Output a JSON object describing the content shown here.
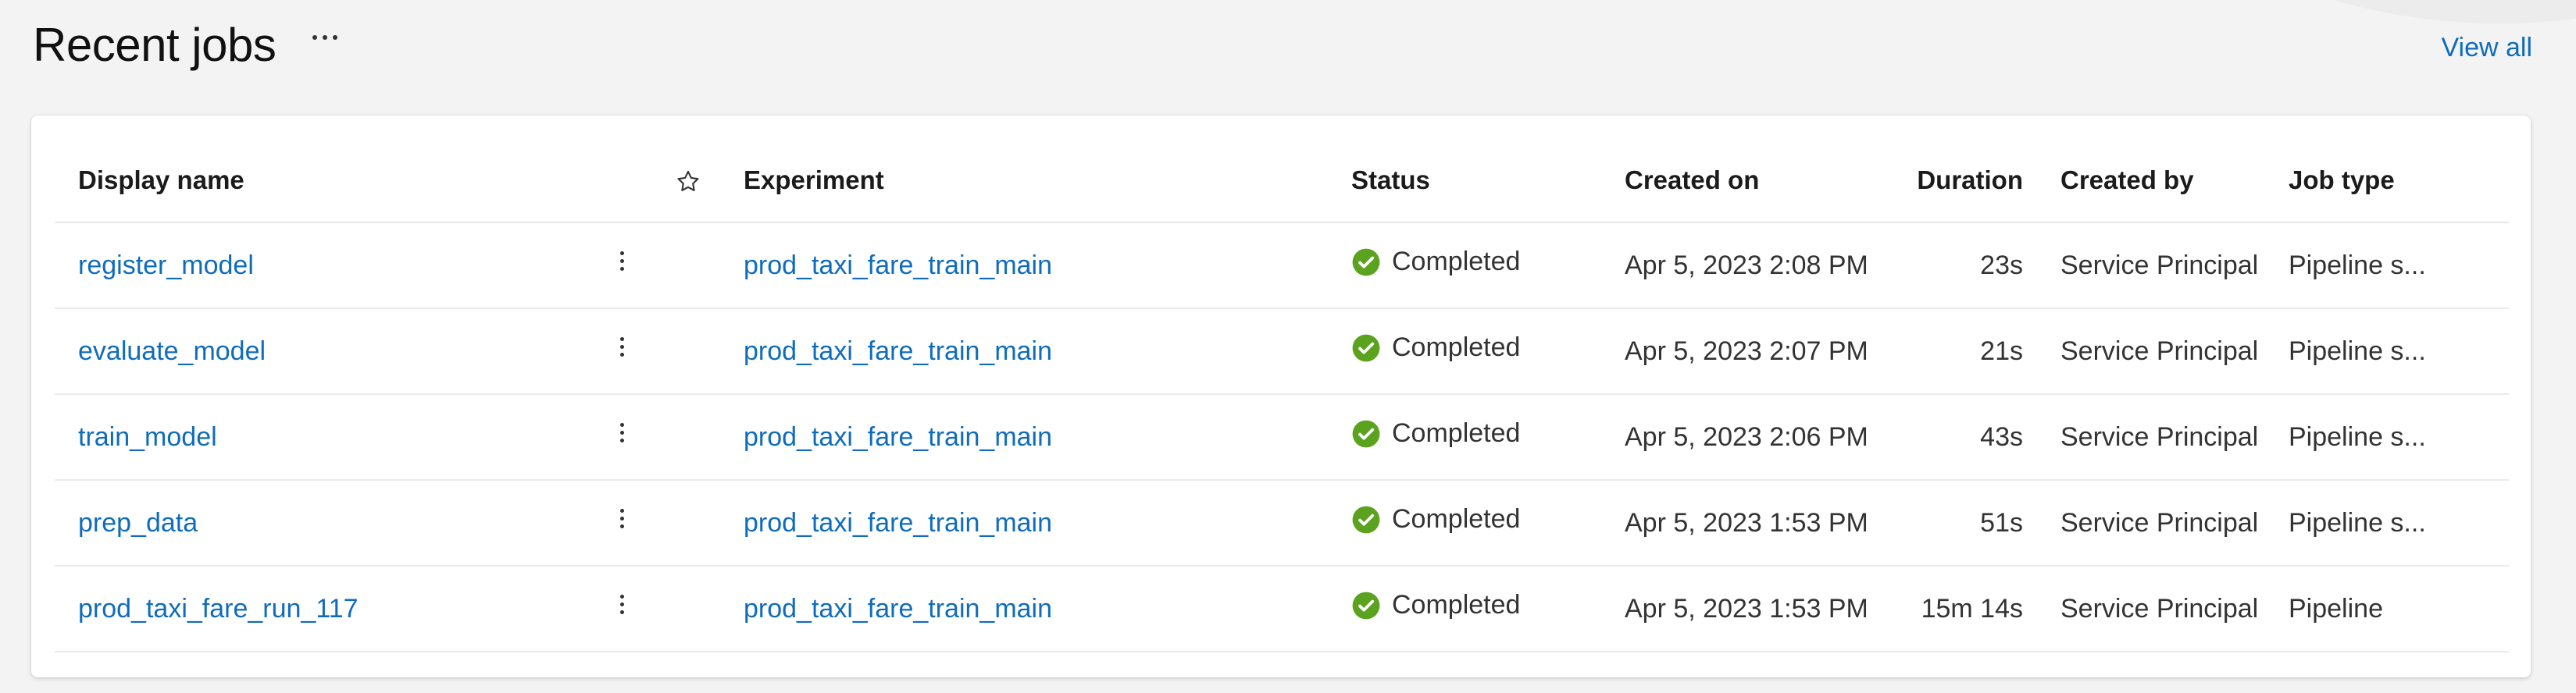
{
  "header": {
    "title": "Recent jobs",
    "more_icon": "more-horizontal-icon",
    "view_all_label": "View all"
  },
  "table": {
    "columns": {
      "display_name": "Display name",
      "favorite_icon": "star-icon",
      "experiment": "Experiment",
      "status": "Status",
      "created_on": "Created on",
      "duration": "Duration",
      "created_by": "Created by",
      "job_type": "Job type"
    },
    "rows": [
      {
        "display_name": "register_model",
        "experiment": "prod_taxi_fare_train_main",
        "status": "Completed",
        "created_on": "Apr 5, 2023 2:08 PM",
        "duration": "23s",
        "created_by": "Service Principal",
        "job_type": "Pipeline s..."
      },
      {
        "display_name": "evaluate_model",
        "experiment": "prod_taxi_fare_train_main",
        "status": "Completed",
        "created_on": "Apr 5, 2023 2:07 PM",
        "duration": "21s",
        "created_by": "Service Principal",
        "job_type": "Pipeline s..."
      },
      {
        "display_name": "train_model",
        "experiment": "prod_taxi_fare_train_main",
        "status": "Completed",
        "created_on": "Apr 5, 2023 2:06 PM",
        "duration": "43s",
        "created_by": "Service Principal",
        "job_type": "Pipeline s..."
      },
      {
        "display_name": "prep_data",
        "experiment": "prod_taxi_fare_train_main",
        "status": "Completed",
        "created_on": "Apr 5, 2023 1:53 PM",
        "duration": "51s",
        "created_by": "Service Principal",
        "job_type": "Pipeline s..."
      },
      {
        "display_name": "prod_taxi_fare_run_117",
        "experiment": "prod_taxi_fare_train_main",
        "status": "Completed",
        "created_on": "Apr 5, 2023 1:53 PM",
        "duration": "15m 14s",
        "created_by": "Service Principal",
        "job_type": "Pipeline"
      }
    ]
  },
  "colors": {
    "link": "#0f6cbd",
    "status_success": "#5ba31f",
    "page_background": "#f3f3f3",
    "card_background": "#ffffff"
  }
}
